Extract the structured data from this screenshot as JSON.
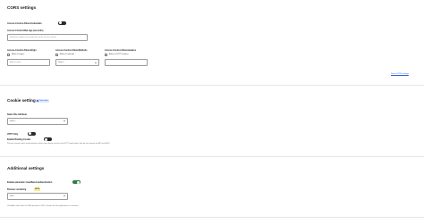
{
  "cors": {
    "title": "CORS settings",
    "allow_credentials_label": "Access-Control-Allow-Credentials",
    "allow_credentials_on": false,
    "max_age_label": "Access-Control-Max-Age (seconds)",
    "max_age_placeholder": "Maximum number of seconds the results can be cached",
    "origin_label": "Access-Control-Allow-Origin",
    "origin_checkbox": "Allow all origins",
    "origin_placeholder": "Add an origin",
    "methods_label": "Access-Control-Allow-Methods",
    "methods_checkbox": "Allow all methods",
    "methods_placeholder": "Select...",
    "headers_label": "Access-Control-Allow-Headers",
    "headers_checkbox": "Allow all HTTP headers",
    "reset_link": "Reset CORS settings"
  },
  "cookie": {
    "title": "Cookie settings",
    "learn_more": "Learn more",
    "samesite_label": "Same Site Attribute",
    "samesite_value": "Select...",
    "http_only_label": "HTTP Only",
    "http_only_on": false,
    "binding_label": "Enable Binding Cookie",
    "binding_on": false,
    "binding_hint": "Prevent session token authentication tokens from being sent for non-HTTP applications that do not support the API and SDK."
  },
  "additional": {
    "title": "Additional settings",
    "auto_auth_label": "Enable automatic cloudflared authentication",
    "auto_auth_on": true,
    "browser_label": "Browser rendering",
    "beta_badge": "BETA",
    "browser_value": "SSH",
    "browser_hint": "Cloudflare will render an SSH terminal or VNC session for this application in a browser."
  },
  "colors": {
    "toggle_off": "#2b2b2b",
    "toggle_on": "#2d7d46",
    "link": "#2f5fd0",
    "learn_badge_bg": "#dbe7ff",
    "beta_badge_bg": "#f6ec9a"
  }
}
